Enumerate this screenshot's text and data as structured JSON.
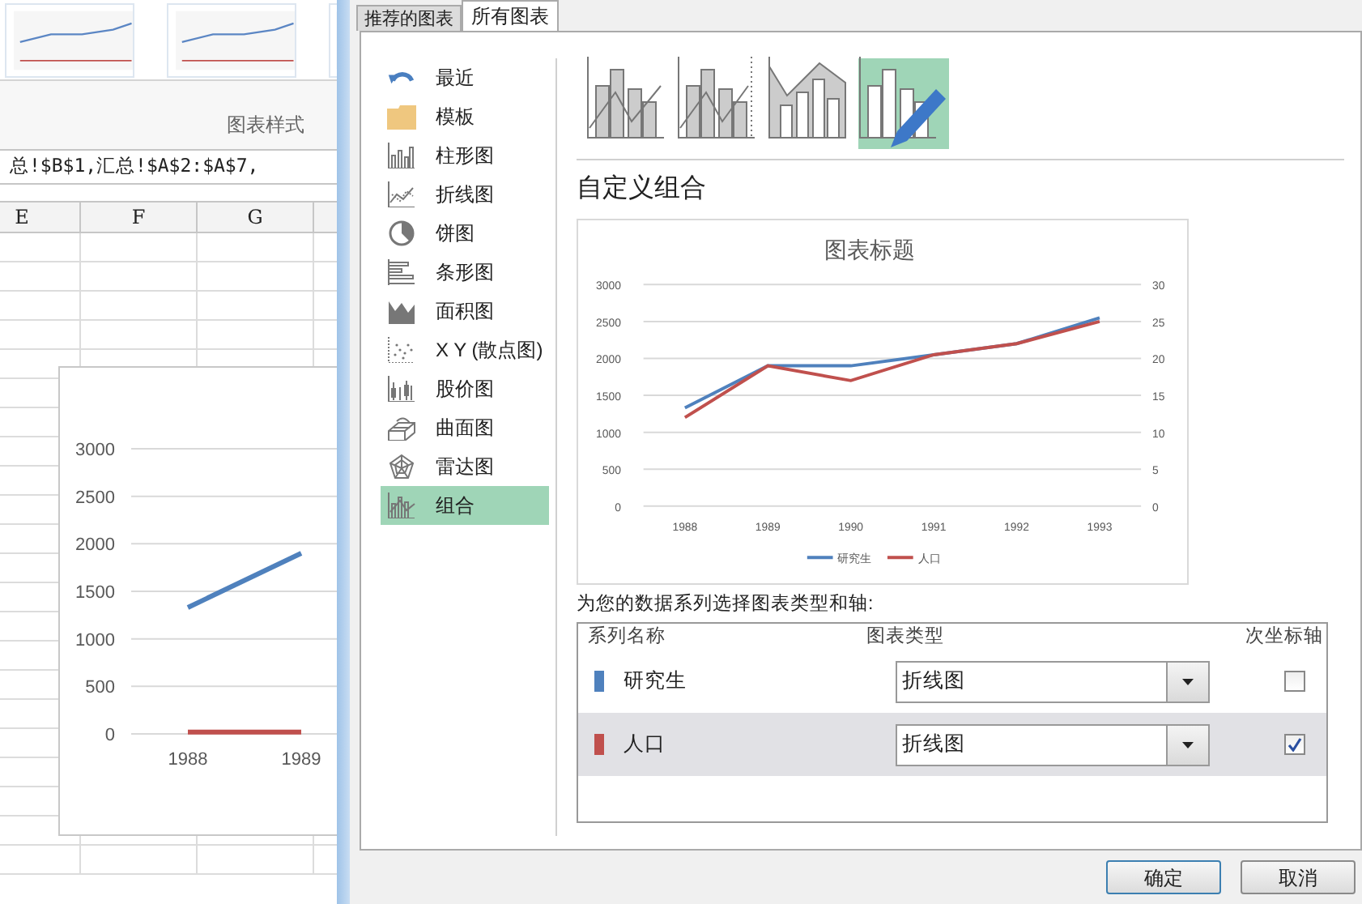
{
  "background_sheet": {
    "ribbon_group_label": "图表样式",
    "formula_bar": "总!$B$1,汇总!$A$2:$A$7,",
    "columns": [
      "E",
      "F",
      "G"
    ],
    "chart": {
      "chart_data": {
        "type": "line",
        "grid": true,
        "categories": [
          "1988",
          "1989"
        ],
        "yticks": [
          0,
          500,
          1000,
          1500,
          2000,
          2500,
          3000
        ],
        "ylim": [
          0,
          3000
        ],
        "series": [
          {
            "color": "#4f81bd",
            "values": [
              1330,
              1900
            ]
          },
          {
            "color": "#c0504d",
            "values": [
              20,
              20
            ]
          }
        ]
      }
    }
  },
  "dialog": {
    "tabs": [
      {
        "label": "推荐的图表",
        "selected": false
      },
      {
        "label": "所有图表",
        "selected": true
      }
    ],
    "sidebar": {
      "items": [
        {
          "label": "最近",
          "kind": "recent",
          "selected": false
        },
        {
          "label": "模板",
          "kind": "templates",
          "selected": false
        },
        {
          "label": "柱形图",
          "kind": "column",
          "selected": false
        },
        {
          "label": "折线图",
          "kind": "line",
          "selected": false
        },
        {
          "label": "饼图",
          "kind": "pie",
          "selected": false
        },
        {
          "label": "条形图",
          "kind": "bar",
          "selected": false
        },
        {
          "label": "面积图",
          "kind": "area",
          "selected": false
        },
        {
          "label": "X Y (散点图)",
          "kind": "scatter",
          "selected": false
        },
        {
          "label": "股价图",
          "kind": "stock",
          "selected": false
        },
        {
          "label": "曲面图",
          "kind": "surface",
          "selected": false
        },
        {
          "label": "雷达图",
          "kind": "radar",
          "selected": false
        },
        {
          "label": "组合",
          "kind": "combo",
          "selected": true
        }
      ]
    },
    "subtypes": [
      {
        "kind": "column-line",
        "selected": false
      },
      {
        "kind": "column-line-secondary",
        "selected": false
      },
      {
        "kind": "area-column",
        "selected": false
      },
      {
        "kind": "custom",
        "selected": true
      }
    ],
    "heading": "自定义组合",
    "preview": {
      "chart_data": {
        "type": "line",
        "grid": true,
        "legend": "bottom",
        "title": "图表标题",
        "categories": [
          "1988",
          "1989",
          "1990",
          "1991",
          "1992",
          "1993"
        ],
        "ylim": [
          0,
          3000
        ],
        "yticks": [
          0,
          500,
          1000,
          1500,
          2000,
          2500,
          3000
        ],
        "y2lim": [
          0,
          30
        ],
        "y2ticks": [
          0,
          5,
          10,
          15,
          20,
          25,
          30
        ],
        "series": [
          {
            "name": "研究生",
            "color": "#4f81bd",
            "values": [
              1330,
              1900,
              1900,
              2050,
              2200,
              2550
            ]
          },
          {
            "name": "人口",
            "color": "#c0504d",
            "axis": "y2",
            "values": [
              12,
              19,
              17,
              20.5,
              22,
              25
            ]
          }
        ]
      }
    },
    "series_prompt": "为您的数据系列选择图表类型和轴:",
    "series_table": {
      "columns": [
        "系列名称",
        "图表类型",
        "次坐标轴"
      ],
      "rows": [
        {
          "name": "研究生",
          "color": "#4f81bd",
          "chart_type": "折线图",
          "secondary_axis": false,
          "selected": false
        },
        {
          "name": "人口",
          "color": "#c0504d",
          "chart_type": "折线图",
          "secondary_axis": true,
          "selected": true
        }
      ]
    },
    "buttons": [
      "确定",
      "取消"
    ]
  }
}
